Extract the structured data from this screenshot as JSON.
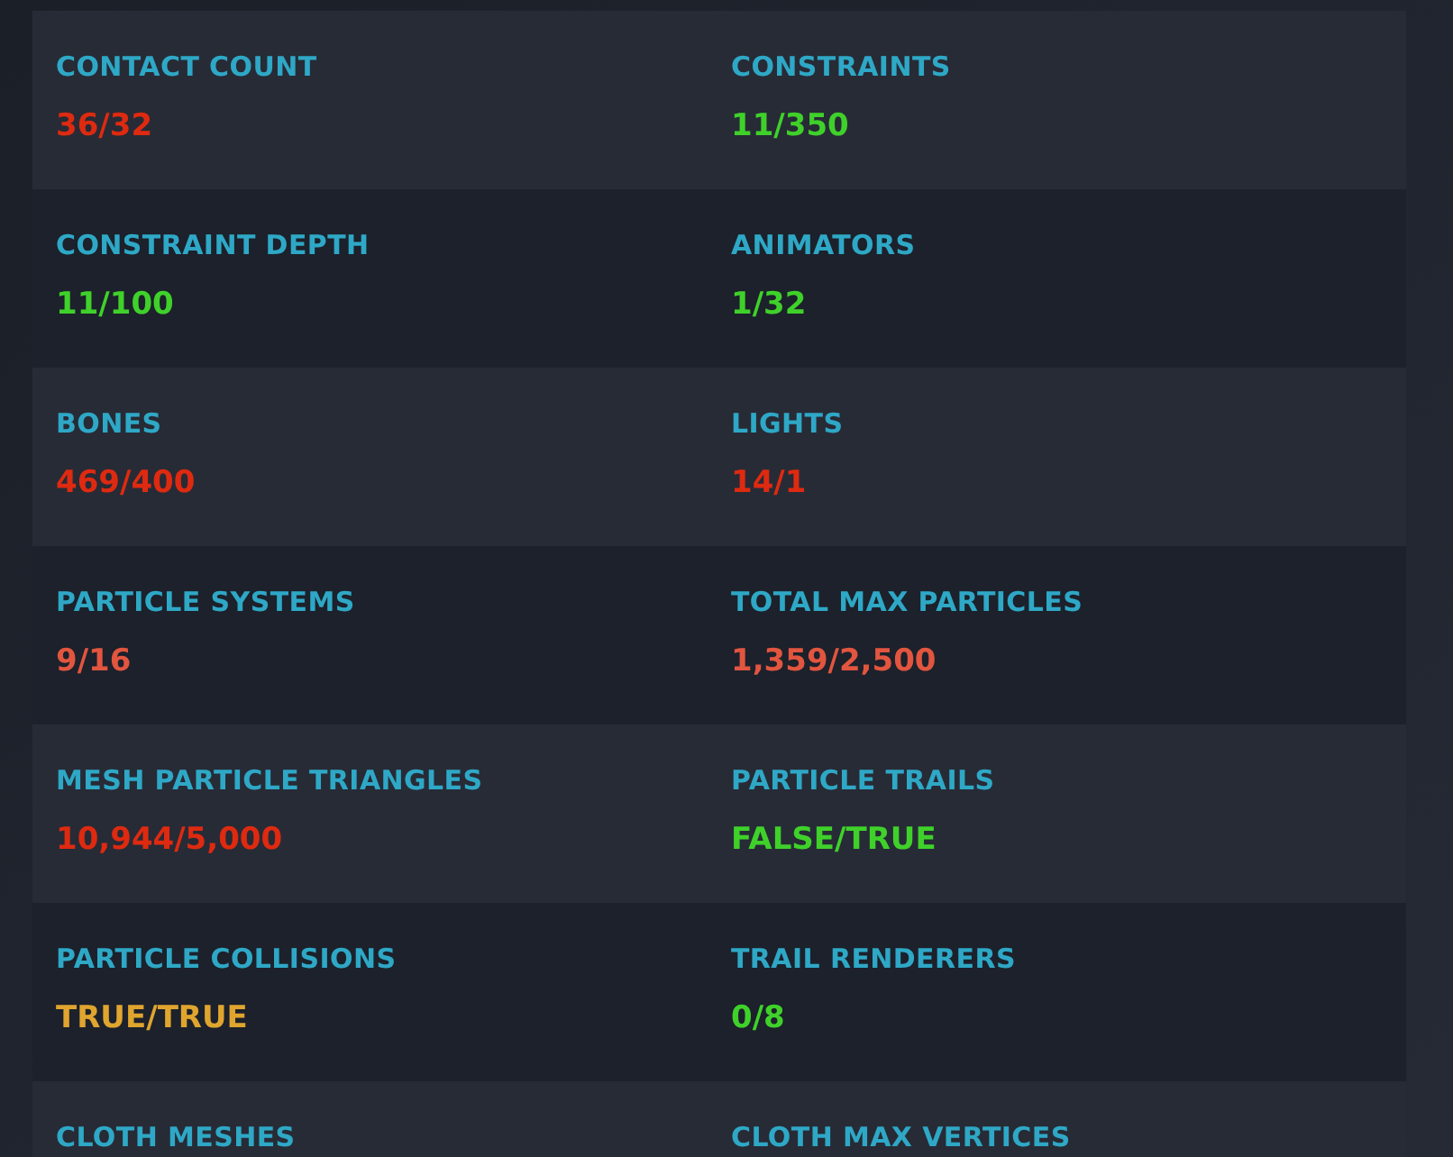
{
  "rows": [
    {
      "cells": [
        {
          "label": "CONTACT COUNT",
          "value": "36/32",
          "color": "#de2a10"
        },
        {
          "label": "CONSTRAINTS",
          "value": "11/350",
          "color": "#3fd12a"
        }
      ]
    },
    {
      "cells": [
        {
          "label": "CONSTRAINT DEPTH",
          "value": "11/100",
          "color": "#3fd12a"
        },
        {
          "label": "ANIMATORS",
          "value": "1/32",
          "color": "#3fd12a"
        }
      ]
    },
    {
      "cells": [
        {
          "label": "BONES",
          "value": "469/400",
          "color": "#de2a10"
        },
        {
          "label": "LIGHTS",
          "value": "14/1",
          "color": "#de2a10"
        }
      ]
    },
    {
      "cells": [
        {
          "label": "PARTICLE SYSTEMS",
          "value": "9/16",
          "color": "#e2553f"
        },
        {
          "label": "TOTAL MAX PARTICLES",
          "value": "1,359/2,500",
          "color": "#e2553f"
        }
      ]
    },
    {
      "cells": [
        {
          "label": "MESH PARTICLE TRIANGLES",
          "value": "10,944/5,000",
          "color": "#de2a10"
        },
        {
          "label": "PARTICLE TRAILS",
          "value": "FALSE/TRUE",
          "color": "#3fd12a"
        }
      ]
    },
    {
      "cells": [
        {
          "label": "PARTICLE COLLISIONS",
          "value": "TRUE/TRUE",
          "color": "#e0a52e"
        },
        {
          "label": "TRAIL RENDERERS",
          "value": "0/8",
          "color": "#3fd12a"
        }
      ]
    },
    {
      "cells": [
        {
          "label": "CLOTH MESHES"
        },
        {
          "label": "CLOTH MAX VERTICES"
        }
      ]
    }
  ]
}
